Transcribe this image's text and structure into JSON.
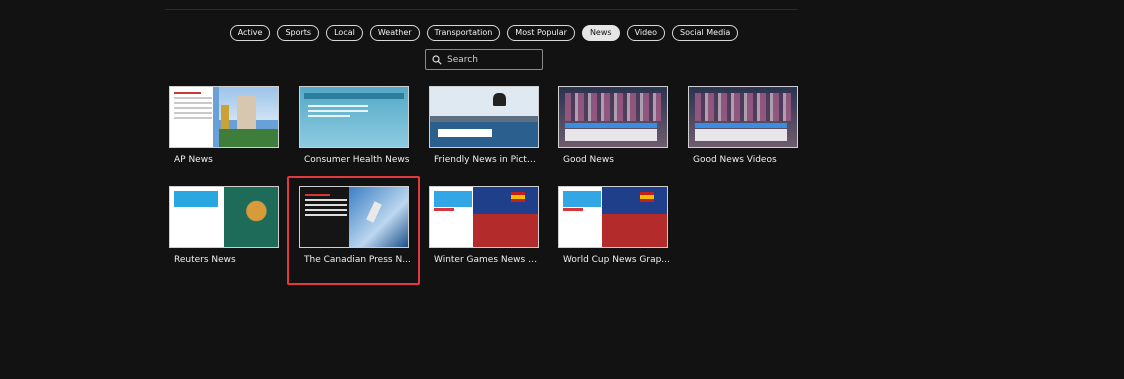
{
  "filters": [
    {
      "label": "Active",
      "active": false
    },
    {
      "label": "Sports",
      "active": false
    },
    {
      "label": "Local",
      "active": false
    },
    {
      "label": "Weather",
      "active": false
    },
    {
      "label": "Transportation",
      "active": false
    },
    {
      "label": "Most Popular",
      "active": false
    },
    {
      "label": "News",
      "active": true
    },
    {
      "label": "Video",
      "active": false
    },
    {
      "label": "Social Media",
      "active": false
    }
  ],
  "search": {
    "placeholder": "Search",
    "icon": "search-icon"
  },
  "colors": {
    "background": "#121212",
    "selected_outline": "#e0393e",
    "chip_border": "#d9d9d9"
  },
  "cards": [
    {
      "title": "AP News",
      "selected": false
    },
    {
      "title": "Consumer Health News",
      "selected": false
    },
    {
      "title": "Friendly News in Pictu...",
      "selected": false
    },
    {
      "title": "Good News",
      "selected": false
    },
    {
      "title": "Good News Videos",
      "selected": false
    },
    {
      "title": "Reuters News",
      "selected": false
    },
    {
      "title": "The Canadian Press N...",
      "selected": true
    },
    {
      "title": "Winter Games News G...",
      "selected": false
    },
    {
      "title": "World Cup News Grap...",
      "selected": false
    }
  ]
}
